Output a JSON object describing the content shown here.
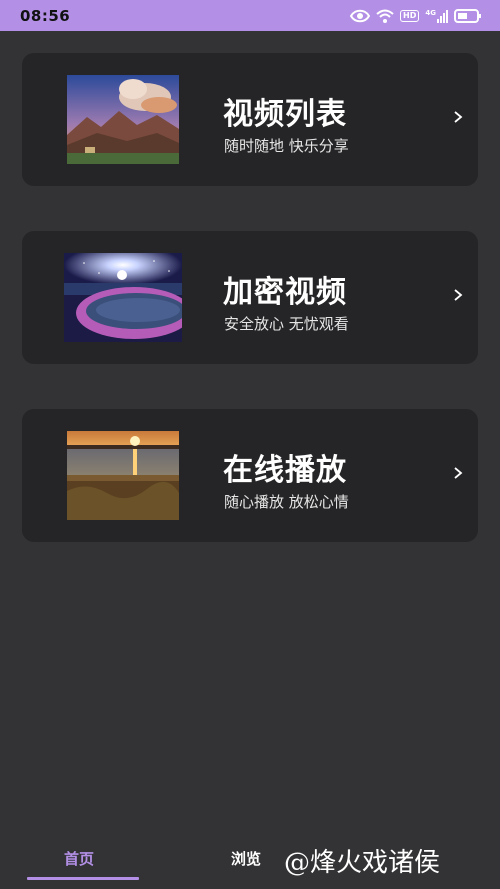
{
  "status_bar": {
    "time": "08:56",
    "icons": [
      "eye-icon",
      "wifi-icon",
      "hd-badge-icon",
      "signal-4g-icon",
      "battery-icon"
    ],
    "hd_label": "HD",
    "network_label": "4G"
  },
  "cards": [
    {
      "title": "视频列表",
      "subtitle": "随时随地 快乐分享",
      "image": "mountain-sunset-image",
      "chevron": "chevron-right-icon"
    },
    {
      "title": "加密视频",
      "subtitle": "安全放心 无忧观看",
      "image": "night-beach-image",
      "chevron": "chevron-right-icon"
    },
    {
      "title": "在线播放",
      "subtitle": "随心播放 放松心情",
      "image": "lake-sunset-image",
      "chevron": "chevron-right-icon"
    }
  ],
  "bottom_nav": {
    "tabs": [
      {
        "label": "首页",
        "active": true
      },
      {
        "label": "浏览",
        "active": false
      }
    ],
    "watermark": "@烽火戏诸侯"
  },
  "colors": {
    "accent": "#b390e6",
    "background": "#333335",
    "card": "#252527"
  }
}
